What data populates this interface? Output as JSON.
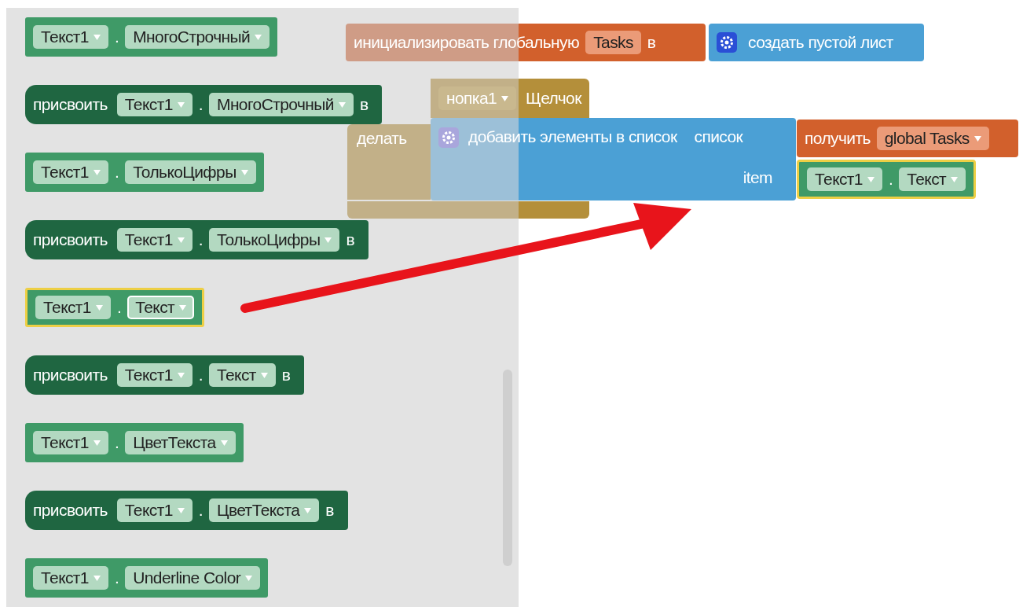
{
  "flyout": {
    "blocks": [
      {
        "kind": "getter",
        "component": "Текст1",
        "separator": ".",
        "property": "МногоСтрочный",
        "selected": false
      },
      {
        "kind": "setter",
        "verb": "присвоить",
        "component": "Текст1",
        "separator": ".",
        "property": "МногоСтрочный",
        "to": "в"
      },
      {
        "kind": "getter",
        "component": "Текст1",
        "separator": ".",
        "property": "ТолькоЦифры",
        "selected": false
      },
      {
        "kind": "setter",
        "verb": "присвоить",
        "component": "Текст1",
        "separator": ".",
        "property": "ТолькоЦифры",
        "to": "в"
      },
      {
        "kind": "getter",
        "component": "Текст1",
        "separator": ".",
        "property": "Текст",
        "selected": true
      },
      {
        "kind": "setter",
        "verb": "присвоить",
        "component": "Текст1",
        "separator": ".",
        "property": "Текст",
        "to": "в"
      },
      {
        "kind": "getter",
        "component": "Текст1",
        "separator": ".",
        "property": "ЦветТекста",
        "selected": false
      },
      {
        "kind": "setter",
        "verb": "присвоить",
        "component": "Текст1",
        "separator": ".",
        "property": "ЦветТекста",
        "to": "в"
      },
      {
        "kind": "getter",
        "component": "Текст1",
        "separator": ".",
        "property": "Underline Color",
        "selected": false
      }
    ]
  },
  "workspace": {
    "init_block": {
      "label": "инициализировать глобальную",
      "name": "Tasks",
      "to": "в",
      "value": {
        "kind": "list-create",
        "label": "создать пустой лист"
      }
    },
    "event_block": {
      "component": "нопка1",
      "event": "Щелчок",
      "do": "делать",
      "statement": {
        "kind": "add-items",
        "label": "добавить элементы в список",
        "list_label": "список",
        "list_value": {
          "verb": "получить",
          "name": "global Tasks"
        },
        "item_label": "item",
        "item_value": {
          "component": "Текст1",
          "separator": ".",
          "property": "Текст",
          "selected": true
        }
      }
    }
  }
}
